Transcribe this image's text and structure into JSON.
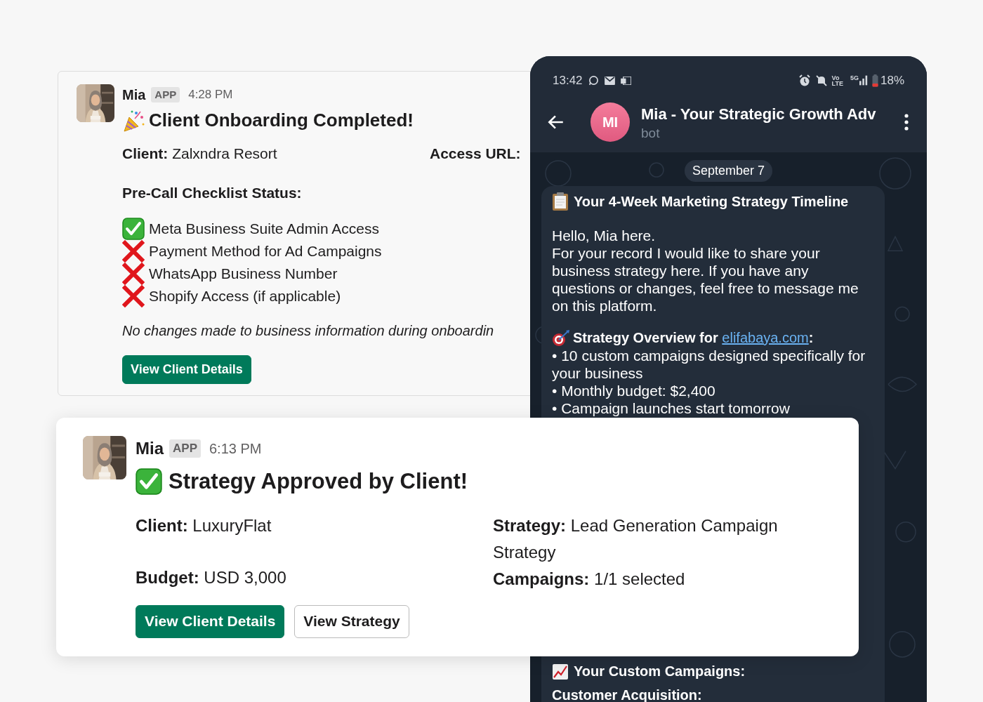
{
  "onboarding_message": {
    "sender": "Mia",
    "badge": "APP",
    "time": "4:28 PM",
    "title": "Client Onboarding Completed!",
    "client_label": "Client:",
    "client_value": "Zalxndra Resort",
    "access_label": "Access URL:",
    "checklist_title": "Pre-Call Checklist Status:",
    "checklist": [
      {
        "label": "Meta Business Suite Admin Access",
        "checked": true
      },
      {
        "label": "Payment Method for Ad Campaigns",
        "checked": false
      },
      {
        "label": "WhatsApp Business Number",
        "checked": false
      },
      {
        "label": "Shopify Access (if applicable)",
        "checked": false
      }
    ],
    "note": "No changes made to business information during onboardin",
    "buttons": [
      {
        "label": "View Client Details",
        "kind": "primary"
      }
    ]
  },
  "phone": {
    "status_bar": {
      "time": "13:42",
      "volte": [
        "Vo",
        "LTE"
      ],
      "network": "5G",
      "battery": "18%"
    },
    "chat_title": "Mia - Your Strategic Growth Adv",
    "chat_subtitle": "bot",
    "avatar_initials": "MI",
    "date": "September 7",
    "message": {
      "title": "Your 4-Week Marketing Strategy Timeline",
      "paragraphs": [
        "Hello, Mia here.",
        "For your record I would like to share your business strategy here. If you have any questions or changes, feel free to message me on this platform."
      ],
      "overview_prefix": "Strategy Overview for",
      "overview_link": "elifabaya.com",
      "overview_suffix": ":",
      "bullets": [
        "• 10 custom campaigns designed specifically for your business",
        "• Monthly budget: $2,400",
        "• Campaign launches start tomorrow"
      ],
      "campaigns_heading": "Your Custom Campaigns:",
      "section": "Customer Acquisition:"
    }
  },
  "approval_message": {
    "sender": "Mia",
    "badge": "APP",
    "time": "6:13 PM",
    "title": "Strategy Approved by Client!",
    "fields_left": [
      {
        "label": "Client:",
        "value": "LuxuryFlat"
      },
      {
        "label": "Budget:",
        "value": "USD 3,000"
      }
    ],
    "fields_right": [
      {
        "label": "Strategy:",
        "value": "Lead Generation Campaign Strategy"
      },
      {
        "label": "Campaigns:",
        "value": "1/1 selected"
      }
    ],
    "buttons": [
      {
        "label": "View Client Details",
        "kind": "primary"
      },
      {
        "label": "View Strategy",
        "kind": "secondary"
      }
    ]
  }
}
